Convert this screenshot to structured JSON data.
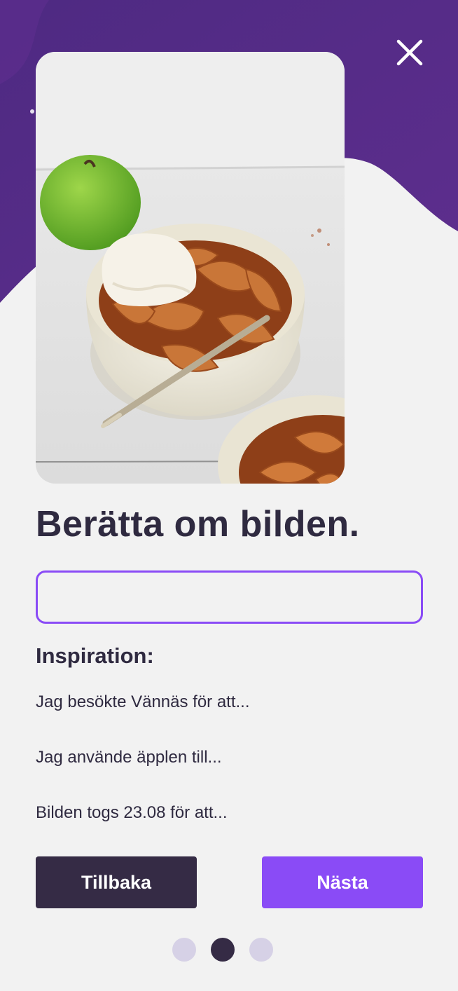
{
  "colors": {
    "background": "#f2f2f2",
    "header_purple": "#5a2d8c",
    "accent": "#8a4bf6",
    "dark": "#352b45",
    "text": "#2f2a40",
    "dot_inactive": "#d6d1e6"
  },
  "header": {
    "close_icon": "close-icon"
  },
  "photo": {
    "icon": "apple-dessert-photo"
  },
  "prompt": {
    "title": "Berätta om bilden.",
    "input_value": "",
    "input_placeholder": ""
  },
  "inspiration": {
    "heading": "Inspiration:",
    "items": [
      "Jag besökte Vännäs för att...",
      "Jag använde äpplen till...",
      "Bilden togs 23.08 för att..."
    ]
  },
  "actions": {
    "back_label": "Tillbaka",
    "next_label": "Nästa"
  },
  "pagination": {
    "total": 3,
    "current": 2
  }
}
